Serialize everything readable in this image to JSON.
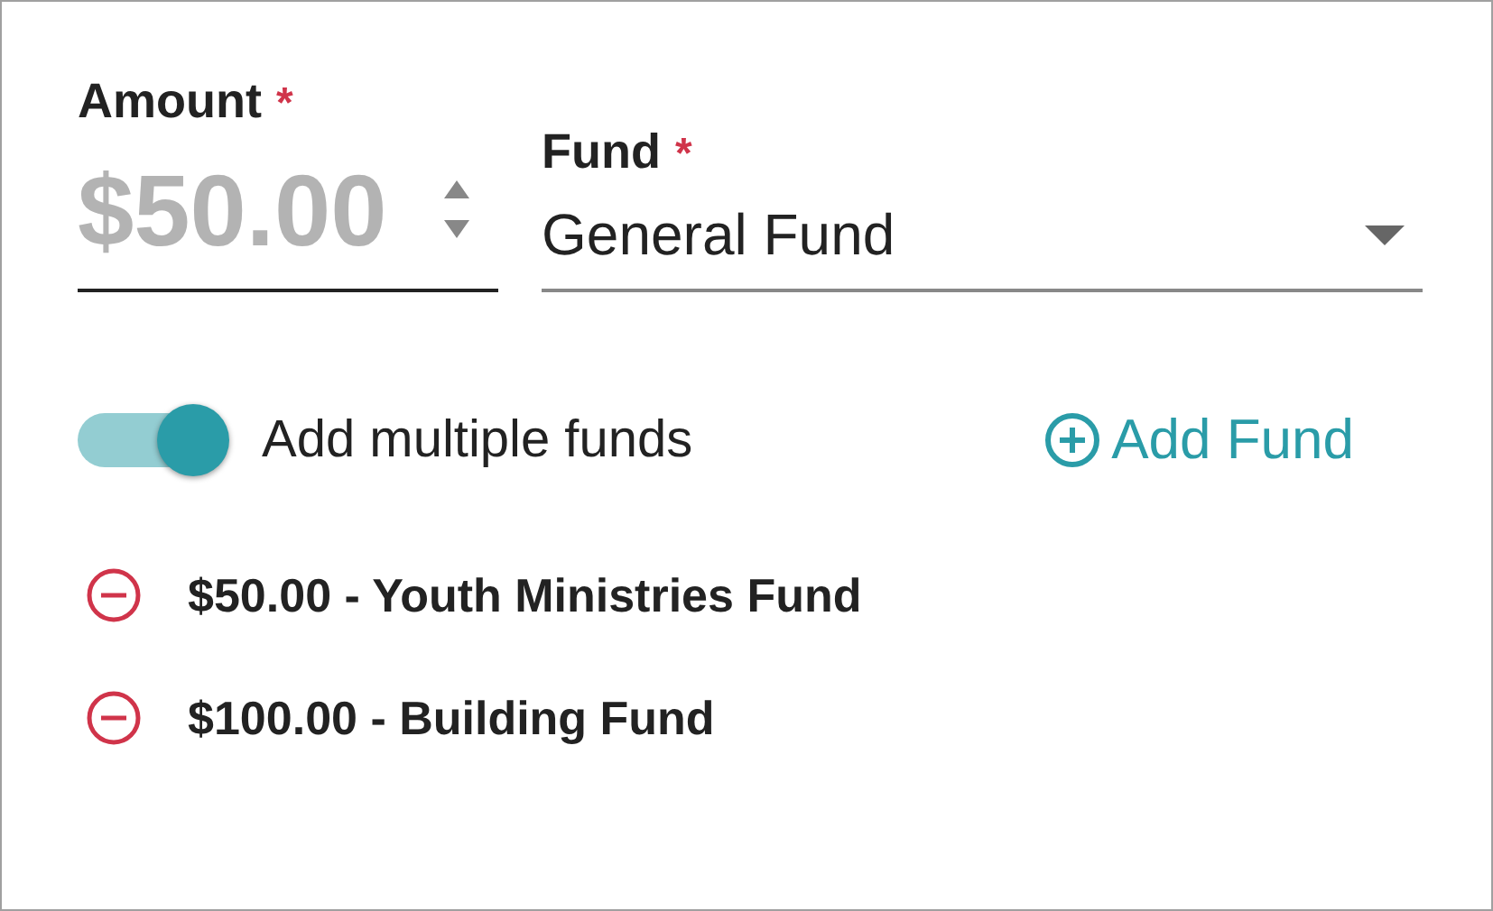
{
  "amount": {
    "label": "Amount",
    "required_mark": "*",
    "placeholder": "$50.00"
  },
  "fund": {
    "label": "Fund",
    "required_mark": "*",
    "value": "General Fund"
  },
  "multiple_funds": {
    "label": "Add multiple funds",
    "on": true
  },
  "add_fund": {
    "label": "Add Fund"
  },
  "funds": [
    {
      "text": "$50.00 - Youth Ministries Fund"
    },
    {
      "text": "$100.00 - Building Fund"
    }
  ]
}
